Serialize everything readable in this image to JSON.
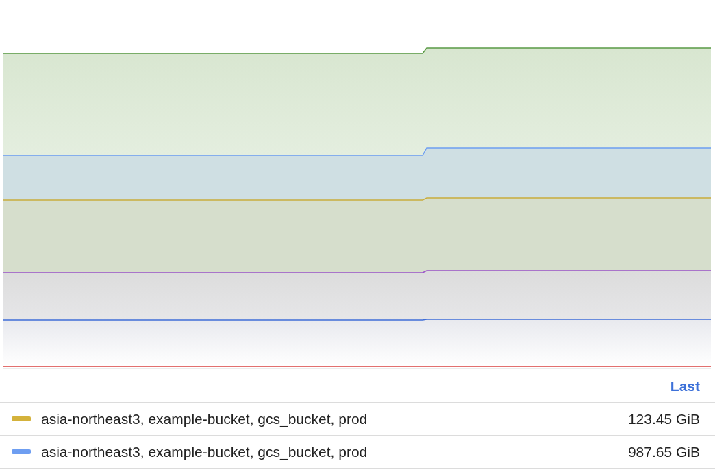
{
  "legend": {
    "header": "Last",
    "rows": [
      {
        "name": "asia-northeast3, example-bucket, gcs_bucket, prod",
        "value": "123.45 GiB",
        "color": "#d4b23b"
      },
      {
        "name": "asia-northeast3, example-bucket, gcs_bucket, prod",
        "value": "987.65 GiB",
        "color": "#6e9ef1"
      }
    ]
  }
}
